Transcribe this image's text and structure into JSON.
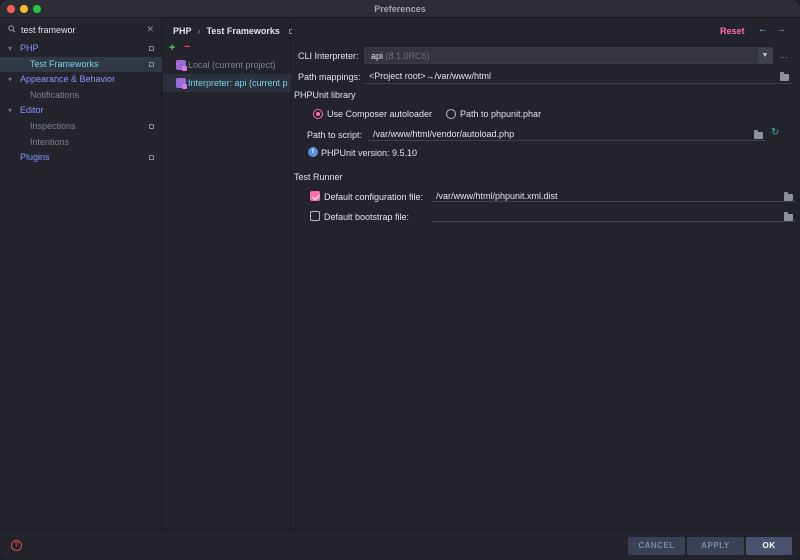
{
  "window": {
    "title": "Preferences"
  },
  "search": {
    "value": "test framewor"
  },
  "sidebar": {
    "items": [
      {
        "label": "PHP",
        "arrow": "▾"
      },
      {
        "label": "Test Frameworks"
      },
      {
        "label": "Appearance & Behavior",
        "arrow": "▾"
      },
      {
        "label": "Notifications"
      },
      {
        "label": "Editor",
        "arrow": "▾"
      },
      {
        "label": "Inspections"
      },
      {
        "label": "Intentions"
      },
      {
        "label": "Plugins"
      }
    ]
  },
  "breadcrumb": {
    "parent": "PHP",
    "separator": "›",
    "current": "Test Frameworks"
  },
  "interpreters": {
    "add": "+",
    "remove": "−",
    "items": [
      {
        "label": "Local (current project)"
      },
      {
        "label": "Interpreter: api (current p"
      }
    ]
  },
  "toolbar": {
    "reset": "Reset",
    "back": "←",
    "forward": "→"
  },
  "cli": {
    "label": "CLI Interpreter:",
    "value": "api",
    "version": "(8.1.0RC6)",
    "more": "..."
  },
  "path_mappings": {
    "label": "Path mappings:",
    "value": "<Project root>→/var/www/html"
  },
  "phpunit": {
    "section": "PHPUnit library",
    "radio_composer": "Use Composer autoloader",
    "radio_phar": "Path to phpunit.phar",
    "path_label": "Path to script:",
    "path_value": "/var/www/html/vendor/autoload.php",
    "version_text": "PHPUnit version: 9.5.10"
  },
  "test_runner": {
    "section": "Test Runner",
    "config_label": "Default configuration file:",
    "config_value": "/var/www/html/phpunit.xml.dist",
    "bootstrap_label": "Default bootstrap file:",
    "bootstrap_value": ""
  },
  "footer": {
    "help": "?",
    "cancel": "CANCEL",
    "apply": "APPLY",
    "ok": "OK"
  },
  "colors": {
    "accent": "#ff6fa8",
    "selected_blue": "#7ad3f0",
    "link_blue": "#8795ff"
  }
}
